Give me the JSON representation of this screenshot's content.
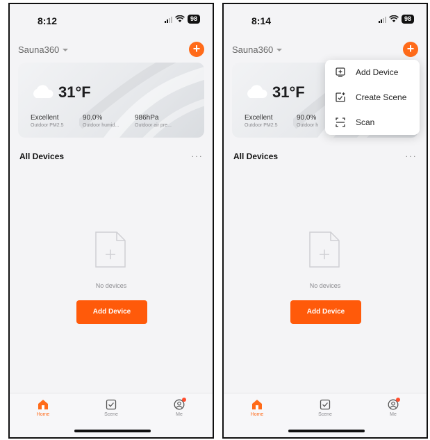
{
  "screens": [
    {
      "status": {
        "time": "8:12",
        "battery": "98"
      },
      "home_name": "Sauna360",
      "weather": {
        "temperature": "31°F",
        "metrics": [
          {
            "value": "Excellent",
            "label": "Outdoor PM2.5"
          },
          {
            "value": "90.0%",
            "label": "Outdoor humid..."
          },
          {
            "value": "986hPa",
            "label": "Outdoor air pre..."
          }
        ]
      },
      "section_title": "All Devices",
      "more_label": "···",
      "empty_text": "No devices",
      "add_device_label": "Add Device",
      "tabs": [
        {
          "label": "Home"
        },
        {
          "label": "Scene"
        },
        {
          "label": "Me"
        }
      ]
    },
    {
      "status": {
        "time": "8:14",
        "battery": "98"
      },
      "home_name": "Sauna360",
      "weather": {
        "temperature": "31°F",
        "metrics": [
          {
            "value": "Excellent",
            "label": "Outdoor PM2.5"
          },
          {
            "value": "90.0%",
            "label": "Outdoor h"
          }
        ]
      },
      "menu": [
        {
          "label": "Add Device",
          "icon": "add-device-icon"
        },
        {
          "label": "Create Scene",
          "icon": "create-scene-icon"
        },
        {
          "label": "Scan",
          "icon": "scan-icon"
        }
      ],
      "section_title": "All Devices",
      "more_label": "···",
      "empty_text": "No devices",
      "add_device_label": "Add Device",
      "tabs": [
        {
          "label": "Home"
        },
        {
          "label": "Scene"
        },
        {
          "label": "Me"
        }
      ]
    }
  ],
  "colors": {
    "accent": "#ff6b1a",
    "button": "#ff5a0a",
    "background": "#f4f4f6"
  }
}
